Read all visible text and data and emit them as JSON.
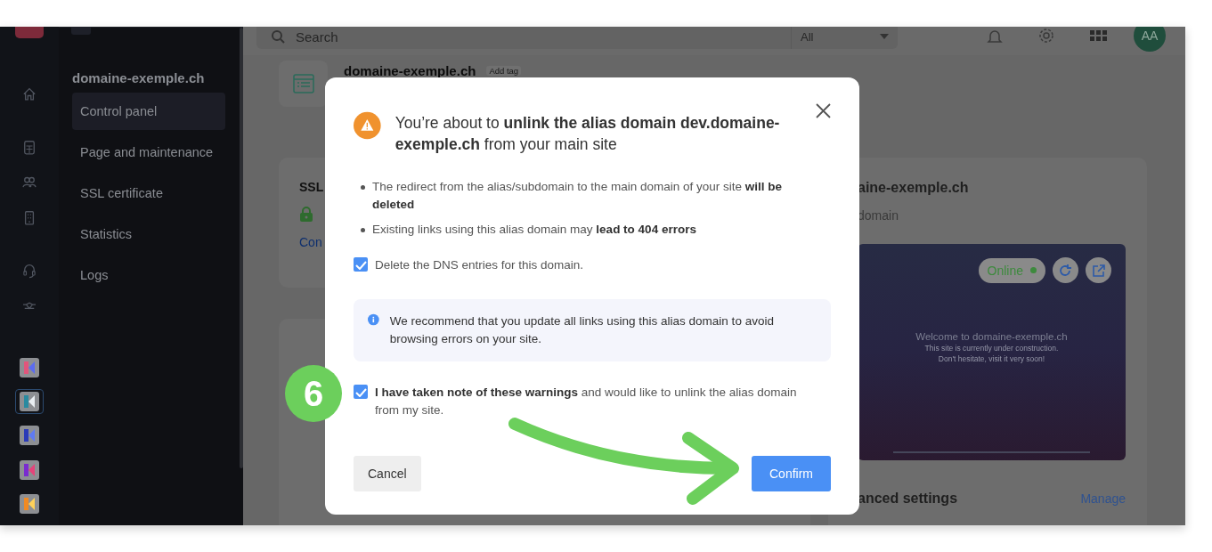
{
  "rail": {
    "apps": [
      {
        "selected": false
      },
      {
        "selected": true
      },
      {
        "selected": false
      },
      {
        "selected": false
      },
      {
        "selected": false
      }
    ]
  },
  "sidebar": {
    "title": "domaine-exemple.ch",
    "items": [
      {
        "label": "Control panel",
        "selected": true
      },
      {
        "label": "Page and maintenance",
        "selected": false
      },
      {
        "label": "SSL certificate",
        "selected": false
      },
      {
        "label": "Statistics",
        "selected": false
      },
      {
        "label": "Logs",
        "selected": false
      }
    ]
  },
  "topbar": {
    "search": {
      "placeholder": "Search"
    },
    "filter": {
      "value": "All"
    },
    "avatar": "AA"
  },
  "header": {
    "title": "domaine-exemple.ch",
    "tag": "Add tag"
  },
  "ssl_card": {
    "title": "SSL",
    "link": "Con"
  },
  "site_card": {
    "title": "aine-exemple.ch",
    "subtitle": "domain",
    "preview": {
      "status": "Online",
      "online": true,
      "heading": "Welcome to domaine-exemple.ch",
      "lines": [
        "This site is currently under construction.",
        "Don't hesitate, visit it very soon!"
      ]
    },
    "settings": "anced settings",
    "manage": "Manage"
  },
  "modal": {
    "title": "You’re about to **unlink the alias domain dev.domaine-exemple.ch** from your main site",
    "bullets": [
      "The redirect from the alias/subdomain to the main domain of your site **will be deleted**",
      "Existing links using this alias domain may **lead to 404 errors**"
    ],
    "dns_option": {
      "label": "Delete the DNS entries for this domain.",
      "checked": true
    },
    "info": "We recommend that you update all links using this alias domain to avoid browsing errors on your site.",
    "acknowledge": {
      "label": "**I have taken note of these warnings** and would like to unlink the alias domain from my site.",
      "checked": true
    },
    "buttons": [
      {
        "label": "Cancel",
        "kind": "secondary"
      },
      {
        "label": "Confirm",
        "kind": "primary"
      }
    ]
  },
  "annotation": {
    "step": "6"
  }
}
